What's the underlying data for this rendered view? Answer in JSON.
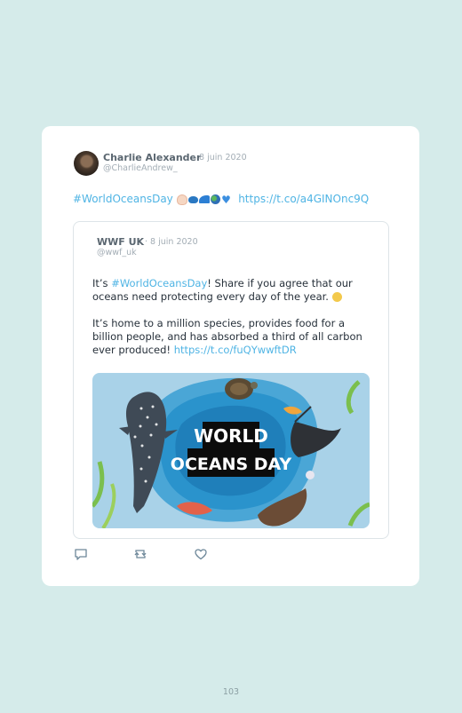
{
  "tweet": {
    "author_name": "Charlie Alexander",
    "author_handle": "@CharlieAndrew_",
    "date": "· 8 juin 2020",
    "hashtag": "#WorldOceansDay",
    "emojis": [
      "hand-icon",
      "whale-icon",
      "wave-icon",
      "globe-icon",
      "blue-heart-icon"
    ],
    "link": "https://t.co/a4GINOnc9Q"
  },
  "quoted_tweet": {
    "author_name": "WWF UK",
    "author_handle": "@wwf_uk",
    "date": "· 8 juin 2020",
    "para1_prefix": "It’s ",
    "para1_hashtag": "#WorldOceansDay",
    "para1_suffix": "! Share if you agree that our oceans need protecting every day of the year.",
    "para2_text": "It’s home to a million species, provides food for a billion people, and has absorbed a third of all carbon ever produced! ",
    "para2_link": "https://t.co/fuQYwwftDR",
    "image": {
      "line1": "WORLD",
      "line2": "OCEANS DAY",
      "background_color": "#a9d2e8",
      "inner_color": "#1f8dc3"
    }
  },
  "actions": [
    "reply-icon",
    "retweet-icon",
    "like-icon"
  ],
  "page_number": "103",
  "colors": {
    "background": "#d5ebea",
    "card": "#ffffff",
    "link": "#4fb4e4"
  }
}
